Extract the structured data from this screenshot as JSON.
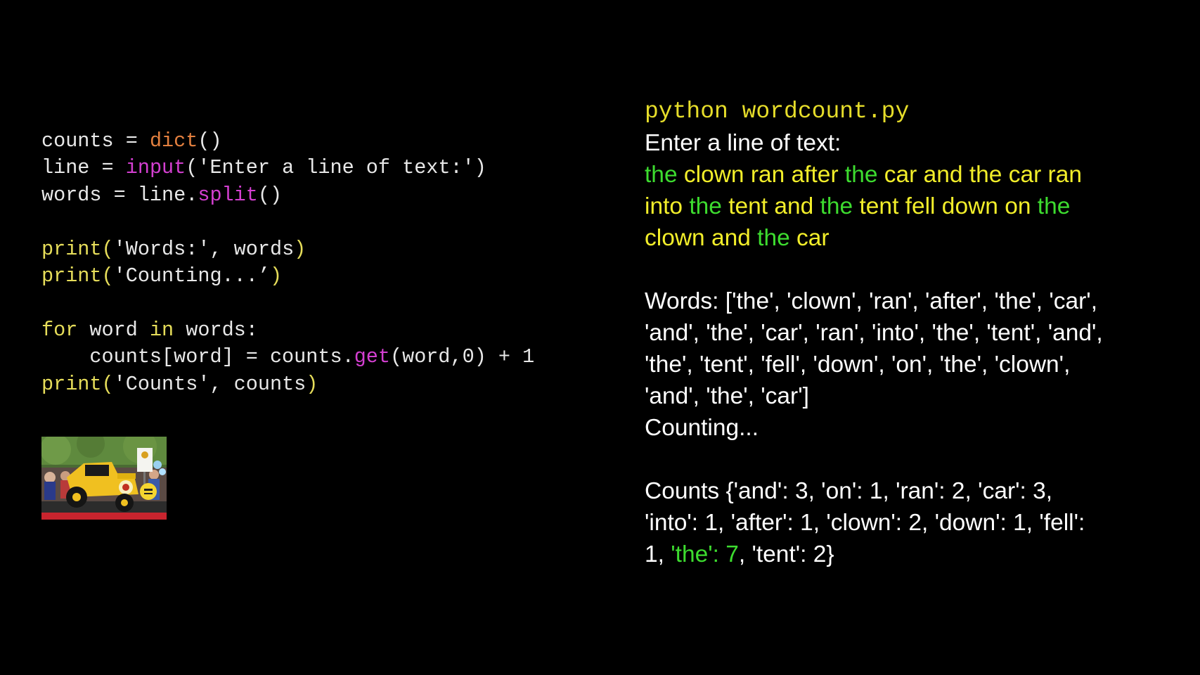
{
  "code": {
    "lines": [
      [
        {
          "t": "counts = ",
          "c": "plain"
        },
        {
          "t": "dict",
          "c": "builtin"
        },
        {
          "t": "()",
          "c": "plain"
        }
      ],
      [
        {
          "t": "line = ",
          "c": "plain"
        },
        {
          "t": "input",
          "c": "method"
        },
        {
          "t": "('Enter a line of text:')",
          "c": "plain"
        }
      ],
      [
        {
          "t": "words = line.",
          "c": "plain"
        },
        {
          "t": "split",
          "c": "method"
        },
        {
          "t": "()",
          "c": "plain"
        }
      ],
      [],
      [
        {
          "t": "print(",
          "c": "kw"
        },
        {
          "t": "'Words:', words",
          "c": "str"
        },
        {
          "t": ")",
          "c": "kw"
        }
      ],
      [
        {
          "t": "print(",
          "c": "kw"
        },
        {
          "t": "'Counting...’",
          "c": "str"
        },
        {
          "t": ")",
          "c": "kw"
        }
      ],
      [],
      [
        {
          "t": "for",
          "c": "kw"
        },
        {
          "t": " word ",
          "c": "plain"
        },
        {
          "t": "in",
          "c": "kw"
        },
        {
          "t": " words:",
          "c": "plain"
        }
      ],
      [
        {
          "t": "    counts[word] = counts.",
          "c": "plain"
        },
        {
          "t": "get",
          "c": "method"
        },
        {
          "t": "(word,0) + 1",
          "c": "plain"
        }
      ],
      [
        {
          "t": "print(",
          "c": "kw"
        },
        {
          "t": "'Counts', counts",
          "c": "str"
        },
        {
          "t": ")",
          "c": "kw"
        }
      ]
    ]
  },
  "console": {
    "command": "python wordcount.py",
    "prompt": "Enter a line of text:",
    "input_lines": [
      [
        {
          "t": "the",
          "c": "green"
        },
        {
          "t": " clown ran after ",
          "c": "yellow"
        },
        {
          "t": "the",
          "c": "green"
        },
        {
          "t": " car and the car ran",
          "c": "yellow"
        }
      ],
      [
        {
          "t": "into ",
          "c": "yellow"
        },
        {
          "t": "the",
          "c": "green"
        },
        {
          "t": " tent and ",
          "c": "yellow"
        },
        {
          "t": "the",
          "c": "green"
        },
        {
          "t": " tent fell down on ",
          "c": "yellow"
        },
        {
          "t": "the",
          "c": "green"
        }
      ],
      [
        {
          "t": "clown and ",
          "c": "yellow"
        },
        {
          "t": "the",
          "c": "green"
        },
        {
          "t": " car",
          "c": "yellow"
        }
      ]
    ],
    "words_lines": [
      "Words: ['the', 'clown', 'ran', 'after', 'the', 'car',",
      "'and', 'the', 'car', 'ran', 'into', 'the', 'tent', 'and',",
      "'the', 'tent', 'fell', 'down', 'on', 'the', 'clown',",
      "'and', 'the', 'car']"
    ],
    "counting": "Counting...",
    "counts_lines": [
      [
        {
          "t": "Counts {'and': 3, 'on': 1, 'ran': 2, 'car': 3,",
          "c": "white"
        }
      ],
      [
        {
          "t": "'into': 1, 'after': 1, 'clown': 2, 'down': 1, 'fell':",
          "c": "white"
        }
      ],
      [
        {
          "t": "1, ",
          "c": "white"
        },
        {
          "t": "'the': 7",
          "c": "green"
        },
        {
          "t": ", 'tent': 2}",
          "c": "white"
        }
      ]
    ]
  },
  "colors": {
    "background": "#000000",
    "code_text": "#e8e8e8",
    "code_builtin": "#e3803f",
    "code_method": "#d33fd0",
    "code_keyword": "#e6dd5a",
    "console_command": "#e6dd2a",
    "highlight_green": "#3ddc2f",
    "input_yellow": "#f2ee2a"
  }
}
